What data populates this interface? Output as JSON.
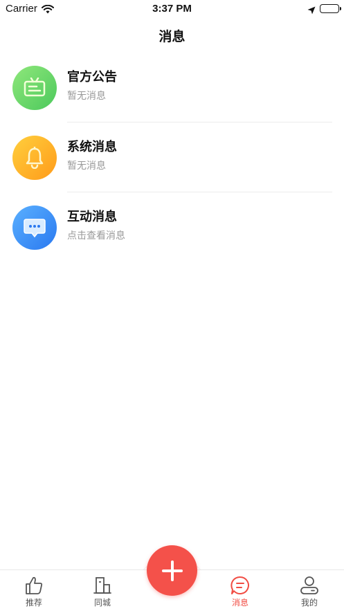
{
  "status_bar": {
    "carrier": "Carrier",
    "time": "3:37 PM"
  },
  "nav": {
    "title": "消息"
  },
  "messages": [
    {
      "title": "官方公告",
      "subtitle": "暂无消息",
      "icon": "announcement-icon",
      "color": "#5fd76a"
    },
    {
      "title": "系统消息",
      "subtitle": "暂无消息",
      "icon": "bell-icon",
      "color": "#ffb128"
    },
    {
      "title": "互动消息",
      "subtitle": "点击查看消息",
      "icon": "chat-bubble-icon",
      "color": "#3b8ef6"
    }
  ],
  "tabbar": {
    "items": [
      {
        "label": "推荐",
        "icon": "thumbs-up-icon",
        "active": false
      },
      {
        "label": "同城",
        "icon": "building-icon",
        "active": false
      },
      {
        "label": "消息",
        "icon": "message-icon",
        "active": true
      },
      {
        "label": "我的",
        "icon": "user-icon",
        "active": false
      }
    ],
    "center_icon": "plus-icon",
    "active_color": "#f14c43"
  }
}
